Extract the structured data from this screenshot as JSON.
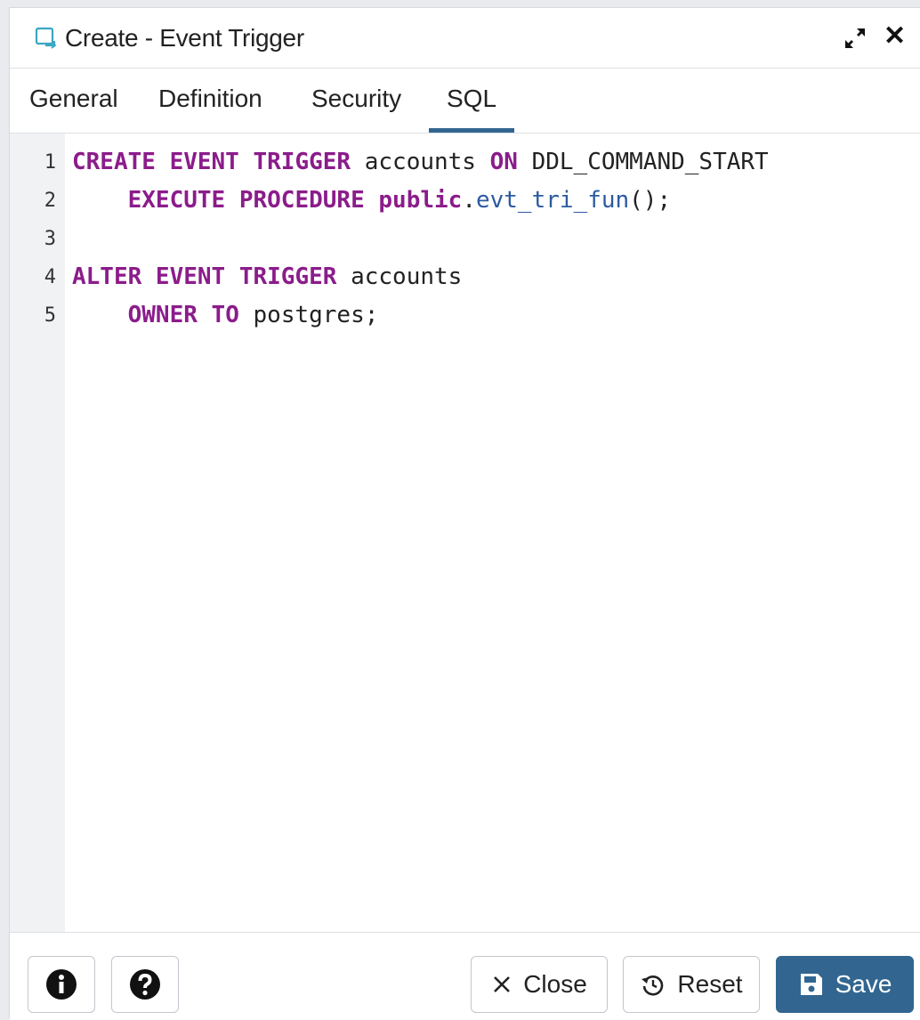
{
  "dialog": {
    "title": "Create - Event Trigger",
    "icons": {
      "title": "event-trigger-icon",
      "expand": "expand-icon",
      "close": "close-icon"
    }
  },
  "tabs": [
    {
      "label": "General"
    },
    {
      "label": "Definition"
    },
    {
      "label": "Security"
    },
    {
      "label": "SQL",
      "active": true
    }
  ],
  "editor": {
    "lines": [
      {
        "num": "1",
        "tokens": [
          {
            "t": "CREATE EVENT TRIGGER",
            "k": "kw"
          },
          {
            "t": " accounts ",
            "k": "plain"
          },
          {
            "t": "ON",
            "k": "kw"
          },
          {
            "t": " DDL_COMMAND_START",
            "k": "plain"
          }
        ]
      },
      {
        "num": "2",
        "tokens": [
          {
            "t": "    ",
            "k": "plain"
          },
          {
            "t": "EXECUTE PROCEDURE",
            "k": "kw"
          },
          {
            "t": " ",
            "k": "plain"
          },
          {
            "t": "public",
            "k": "kw"
          },
          {
            "t": ".",
            "k": "plain"
          },
          {
            "t": "evt_tri_fun",
            "k": "fn"
          },
          {
            "t": "();",
            "k": "plain"
          }
        ]
      },
      {
        "num": "3",
        "tokens": []
      },
      {
        "num": "4",
        "tokens": [
          {
            "t": "ALTER EVENT TRIGGER",
            "k": "kw"
          },
          {
            "t": " accounts",
            "k": "plain"
          }
        ]
      },
      {
        "num": "5",
        "tokens": [
          {
            "t": "    ",
            "k": "plain"
          },
          {
            "t": "OWNER TO",
            "k": "kw"
          },
          {
            "t": " postgres;",
            "k": "plain"
          }
        ]
      }
    ]
  },
  "footer": {
    "info_icon": "info-icon",
    "help_icon": "help-icon",
    "close_label": "Close",
    "reset_label": "Reset",
    "save_label": "Save"
  },
  "colors": {
    "accent": "#326690",
    "keyword": "#8b1c8b",
    "function": "#2c5aa0",
    "title_icon": "#3aa7c4"
  }
}
